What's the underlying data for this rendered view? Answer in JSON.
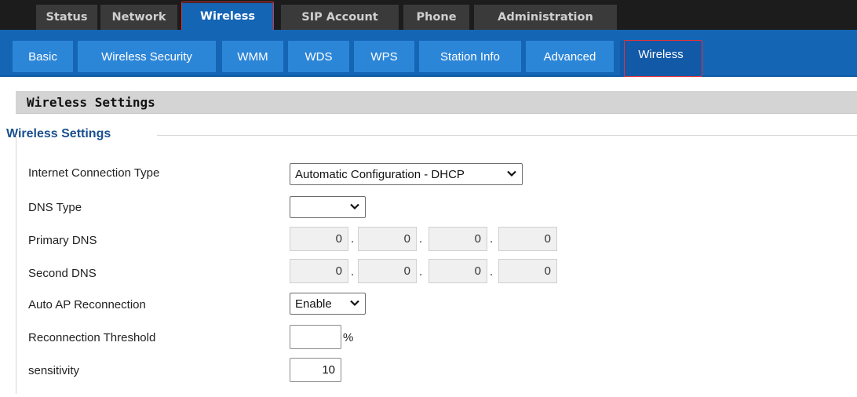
{
  "top_nav": {
    "tabs": [
      {
        "label": "Status"
      },
      {
        "label": "Network"
      },
      {
        "label": "Wireless"
      },
      {
        "label": "SIP Account"
      },
      {
        "label": "Phone"
      },
      {
        "label": "Administration"
      }
    ],
    "active": "Wireless"
  },
  "sub_nav": {
    "tabs": [
      {
        "label": "Basic"
      },
      {
        "label": "Wireless Security"
      },
      {
        "label": "WMM"
      },
      {
        "label": "WDS"
      },
      {
        "label": "WPS"
      },
      {
        "label": "Station Info"
      },
      {
        "label": "Advanced"
      },
      {
        "label": "Wireless"
      }
    ],
    "active": "Wireless"
  },
  "section": {
    "header": "Wireless Settings",
    "legend": "Wireless Settings"
  },
  "form": {
    "connection_type": {
      "label": "Internet Connection Type",
      "value": "Automatic Configuration - DHCP"
    },
    "dns_type": {
      "label": "DNS Type",
      "value": ""
    },
    "primary_dns": {
      "label": "Primary DNS",
      "octets": [
        "0",
        "0",
        "0",
        "0"
      ]
    },
    "second_dns": {
      "label": "Second DNS",
      "octets": [
        "0",
        "0",
        "0",
        "0"
      ]
    },
    "auto_ap": {
      "label": "Auto AP Reconnection",
      "value": "Enable"
    },
    "threshold": {
      "label": "Reconnection Threshold",
      "value": "",
      "unit": "%"
    },
    "sensitivity": {
      "label": "sensitivity",
      "value": "10"
    }
  },
  "colors": {
    "top_bar": "#1c1c1c",
    "top_tab": "#3a3a3a",
    "accent_blue": "#1565b5",
    "sub_tab": "#2c86d8",
    "highlight_red": "#e0323a",
    "legend_text": "#1a4f8f"
  }
}
